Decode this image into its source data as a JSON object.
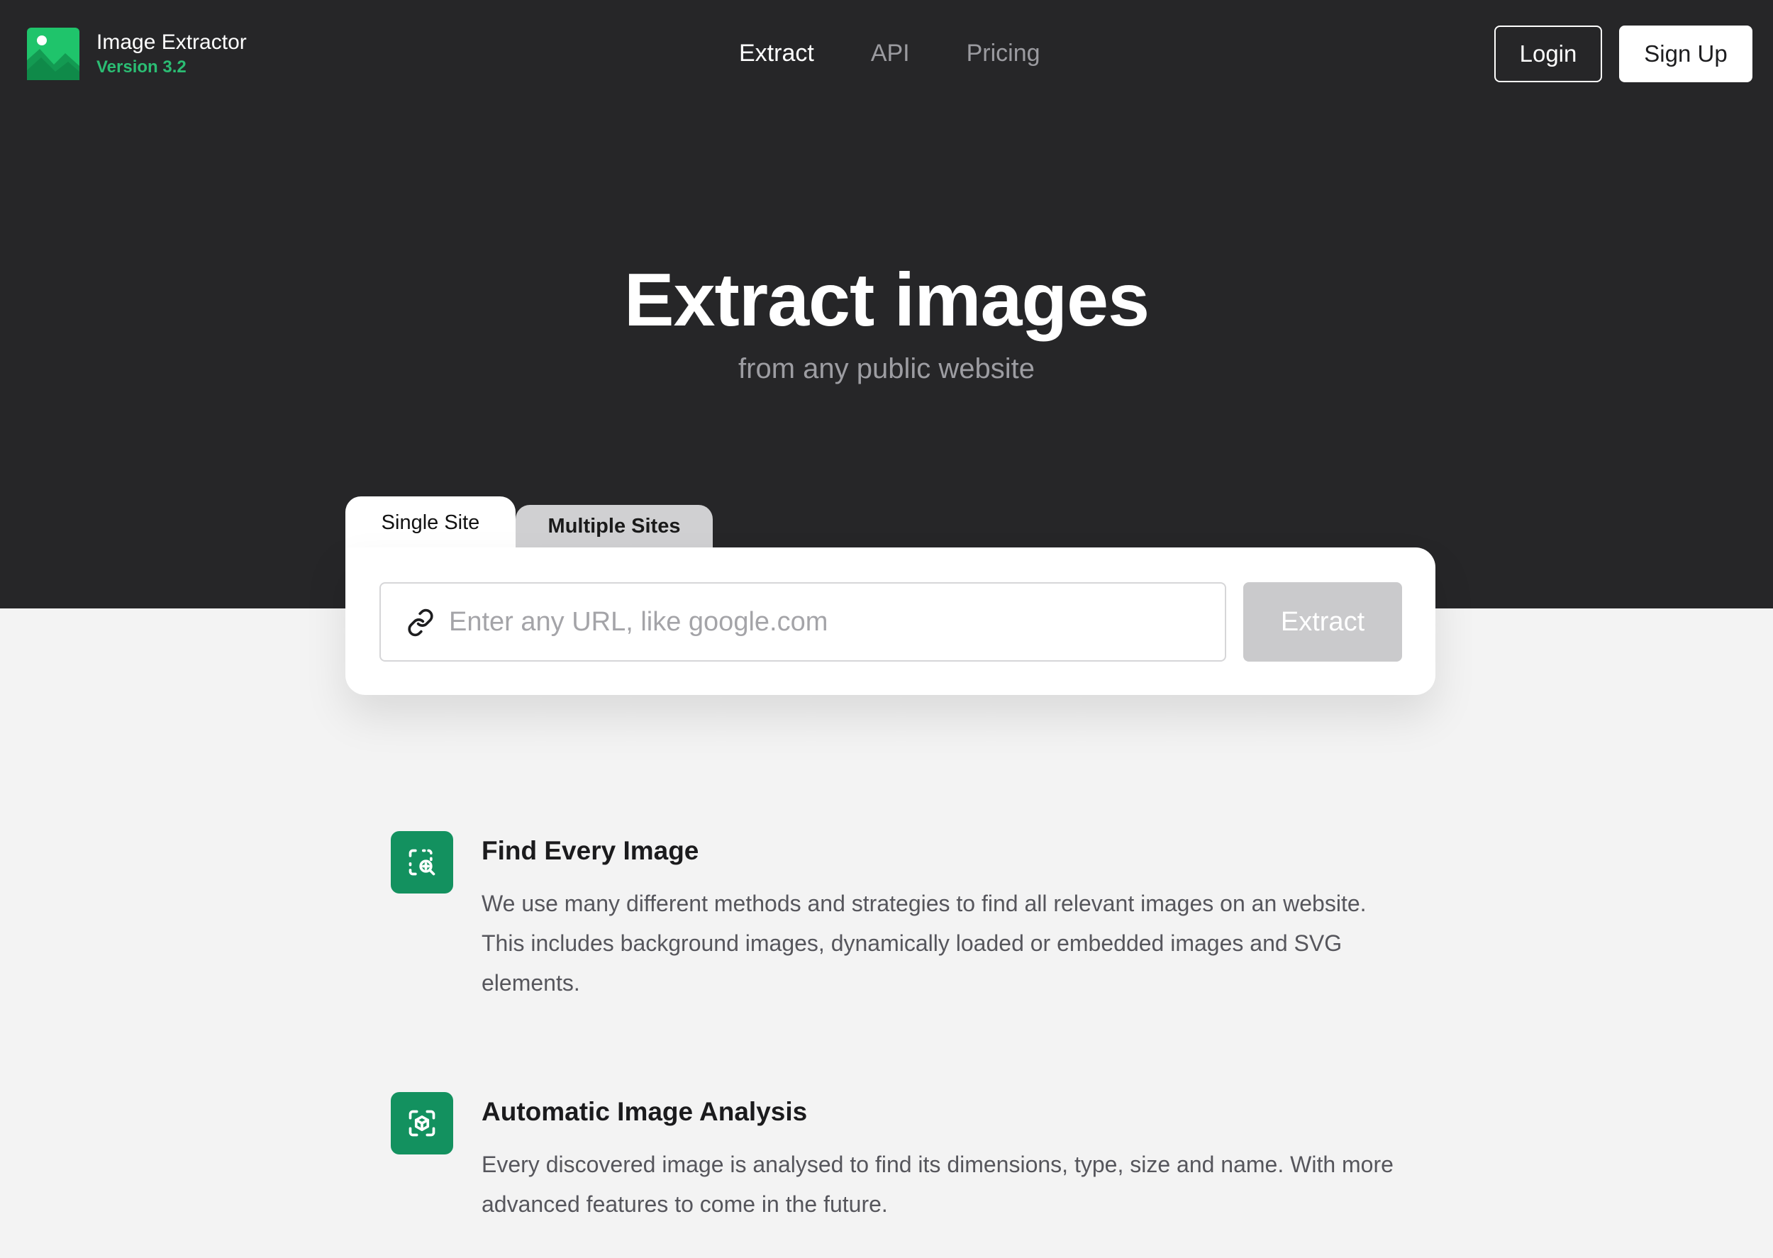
{
  "app": {
    "name": "Image Extractor",
    "version": "Version 3.2",
    "brand_color": "#2bbd73"
  },
  "nav": {
    "items": [
      {
        "label": "Extract",
        "active": true
      },
      {
        "label": "API",
        "active": false
      },
      {
        "label": "Pricing",
        "active": false
      }
    ]
  },
  "auth": {
    "login_label": "Login",
    "signup_label": "Sign Up"
  },
  "hero": {
    "title": "Extract images",
    "subtitle": "from any public website"
  },
  "extractor": {
    "tabs": [
      {
        "label": "Single Site",
        "selected": true
      },
      {
        "label": "Multiple Sites",
        "selected": false
      }
    ],
    "url_placeholder": "Enter any URL, like google.com",
    "url_value": "",
    "extract_label": "Extract",
    "extract_enabled": false
  },
  "features": [
    {
      "icon": "image-search-icon",
      "title": "Find Every Image",
      "description": "We use many different methods and strategies to find all relevant images on an website. This includes background images, dynamically loaded or embedded images and SVG elements."
    },
    {
      "icon": "image-analysis-icon",
      "title": "Automatic Image Analysis",
      "description": "Every discovered image is analysed to find its dimensions, type, size and name. With more advanced features to come in the future."
    }
  ],
  "colors": {
    "header_bg": "#262628",
    "page_bg": "#f3f3f3",
    "feature_icon_bg": "#13915f",
    "extract_disabled_bg": "#cacacc"
  }
}
